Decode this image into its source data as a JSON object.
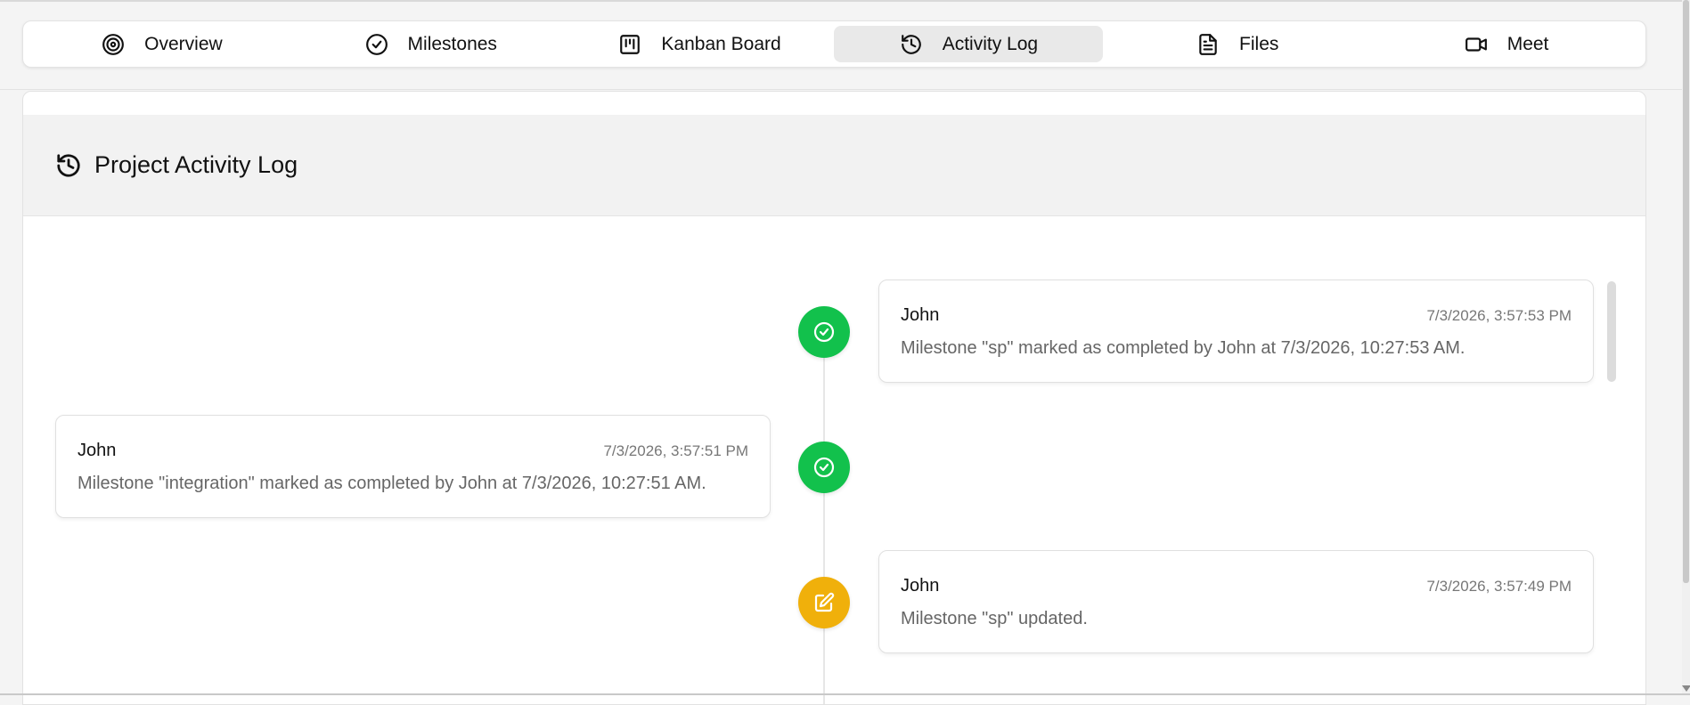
{
  "tabs": [
    {
      "label": "Overview",
      "icon": "target-icon"
    },
    {
      "label": "Milestones",
      "icon": "check-circle-icon"
    },
    {
      "label": "Kanban Board",
      "icon": "kanban-icon"
    },
    {
      "label": "Activity Log",
      "icon": "history-icon",
      "active": true
    },
    {
      "label": "Files",
      "icon": "file-text-icon"
    },
    {
      "label": "Meet",
      "icon": "video-icon"
    }
  ],
  "header": {
    "title": "Project Activity Log",
    "icon": "history-icon"
  },
  "colors": {
    "completed": "#12c14c",
    "updated": "#f0b00b"
  },
  "activities": [
    {
      "user": "John",
      "time": "7/3/2026, 3:57:53 PM",
      "message": "Milestone \"sp\" marked as completed by John at 7/3/2026, 10:27:53 AM.",
      "type": "completed",
      "icon": "check-circle-icon",
      "side": "right"
    },
    {
      "user": "John",
      "time": "7/3/2026, 3:57:51 PM",
      "message": "Milestone \"integration\" marked as completed by John at 7/3/2026, 10:27:51 AM.",
      "type": "completed",
      "icon": "check-circle-icon",
      "side": "left"
    },
    {
      "user": "John",
      "time": "7/3/2026, 3:57:49 PM",
      "message": "Milestone \"sp\" updated.",
      "type": "updated",
      "icon": "edit-icon",
      "side": "right"
    }
  ]
}
